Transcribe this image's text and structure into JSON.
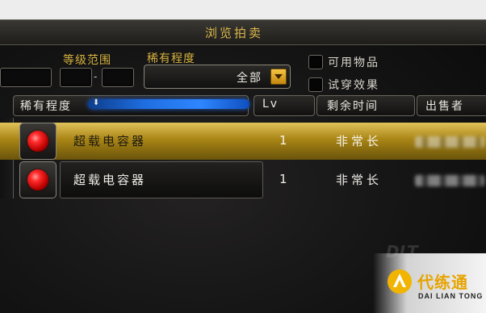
{
  "window": {
    "title": "浏览拍卖"
  },
  "filters": {
    "level_range_label": "等级范围",
    "level_dash": "-",
    "rarity_label": "稀有程度",
    "rarity_selected": "全部",
    "usable_label": "可用物品",
    "tryon_label": "试穿效果"
  },
  "columns": {
    "rarity": "稀有程度",
    "sort_arrow": "⬇",
    "lv": "Lv",
    "time_left": "剩余时间",
    "seller": "出售者"
  },
  "rows": [
    {
      "name": "超载电容器",
      "lv": "1",
      "time": "非常长",
      "selected": true
    },
    {
      "name": "超载电容器",
      "lv": "1",
      "time": "非常长",
      "selected": false
    }
  ],
  "watermark": {
    "text": "代练通",
    "sub": "DAI LIAN TONG"
  },
  "colors": {
    "gold": "#d7b23e",
    "selected_row": "#a98515",
    "sort_bar": "#2e86ff"
  }
}
